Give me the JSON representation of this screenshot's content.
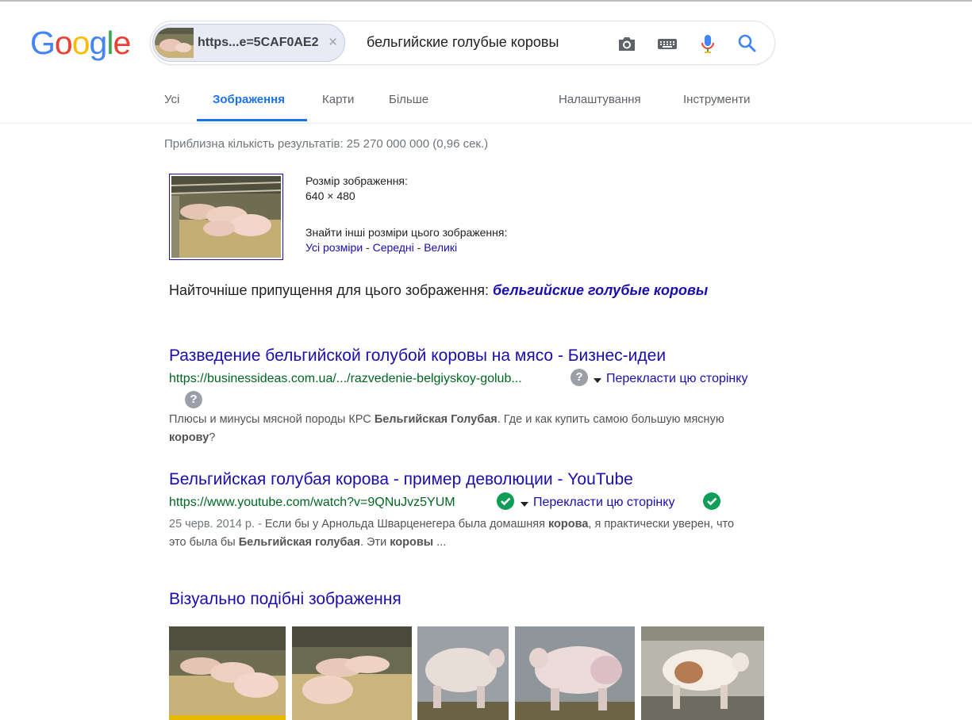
{
  "logo": {
    "letters": [
      "G",
      "o",
      "o",
      "g",
      "l",
      "e"
    ],
    "colors": [
      "#4285f4",
      "#ea4335",
      "#fbbc05",
      "#4285f4",
      "#34a853",
      "#ea4335"
    ]
  },
  "search": {
    "chip_text": "https...e=5CAF0AE2",
    "chip_close": "×",
    "query": "бельгийские голубые коровы"
  },
  "tabs": {
    "all": "Усі",
    "images": "Зображення",
    "maps": "Карти",
    "more": "Більше",
    "settings": "Налаштування",
    "tools": "Інструменти"
  },
  "stats": "Приблизна кількість результатів: 25 270 000 000 (0,96 сек.)",
  "image_info": {
    "size_label": "Розмір зображення:",
    "size_value": "640 × 480",
    "other_sizes_label": "Знайти інші розміри цього зображення:",
    "all_sizes": "Усі розміри",
    "sep": " - ",
    "medium": "Середні",
    "large": "Великі"
  },
  "best_guess": {
    "label": "Найточніше припущення для цього зображення: ",
    "value": "бельгийские голубые коровы"
  },
  "results": [
    {
      "title": "Разведение бельгийской голубой коровы на мясо - Бизнес-идеи",
      "url": "https://businessideas.com.ua/.../razvedenie-belgiyskoy-golub...",
      "translate": "Перекласти цю сторінку",
      "snippet_1": "Плюсы и минусы мясной породы КРС ",
      "snippet_1b": "Бельгийская Голубая",
      "snippet_2": ". Где и как купить самою большую мясную ",
      "snippet_2b": "корову",
      "snippet_3": "?"
    },
    {
      "title": "Бельгийская голубая корова - пример деволюции - YouTube",
      "url": "https://www.youtube.com/watch?v=9QNuJvz5YUM",
      "translate": "Перекласти цю сторінку",
      "date": "25 черв. 2014 р. - ",
      "snippet_1": "Если бы у Арнольда Шварценегера была домашняя ",
      "snippet_1b": "корова",
      "snippet_2": ", я практически уверен, что это была бы ",
      "snippet_2b": "Бельгийская голубая",
      "snippet_3": ". Эти ",
      "snippet_3b": "коровы",
      "snippet_4": " ..."
    }
  ],
  "similar": {
    "title": "Візуально подібні зображення"
  },
  "colors": {
    "link": "#1a0dab",
    "url_green": "#006621",
    "active_tab": "#1a73e8"
  }
}
